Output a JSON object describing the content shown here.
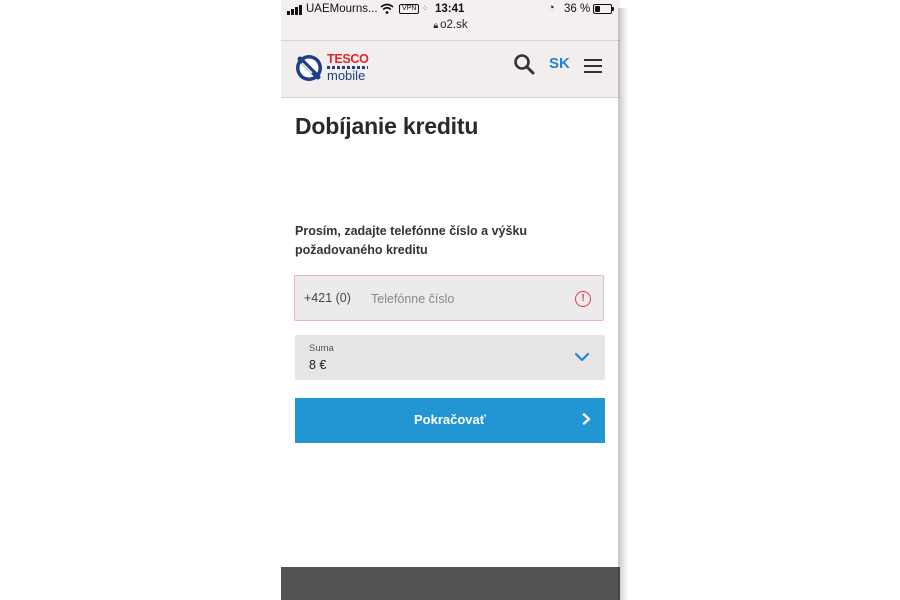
{
  "status_bar": {
    "carrier": "UAEMourns...",
    "vpn_badge": "VPN",
    "time": "13:41",
    "battery_percent": "36 %",
    "battery_level": 0.36,
    "url": "o2.sk"
  },
  "header": {
    "logo_tesco": "TESCO",
    "logo_mobile": "mobile",
    "language": "SK",
    "search_icon": "search-icon",
    "menu_icon": "hamburger-menu-icon"
  },
  "page": {
    "title": "Dobíjanie kreditu",
    "instruction": "Prosím, zadajte telefónne číslo a výšku požadovaného kreditu"
  },
  "phone_field": {
    "prefix": "+421 (0)",
    "placeholder": "Telefónne číslo",
    "value": "",
    "error_icon": "alert-circle-icon"
  },
  "amount_field": {
    "label": "Suma",
    "value": "8 €",
    "chevron_icon": "chevron-down-icon"
  },
  "continue_button": {
    "label": "Pokračovať",
    "chevron_icon": "chevron-right-icon"
  },
  "colors": {
    "accent_blue": "#2196d3",
    "brand_red": "#e1252f",
    "brand_navy": "#1d3e8a",
    "error_red": "#e23b47",
    "footer_gray": "#545454"
  }
}
